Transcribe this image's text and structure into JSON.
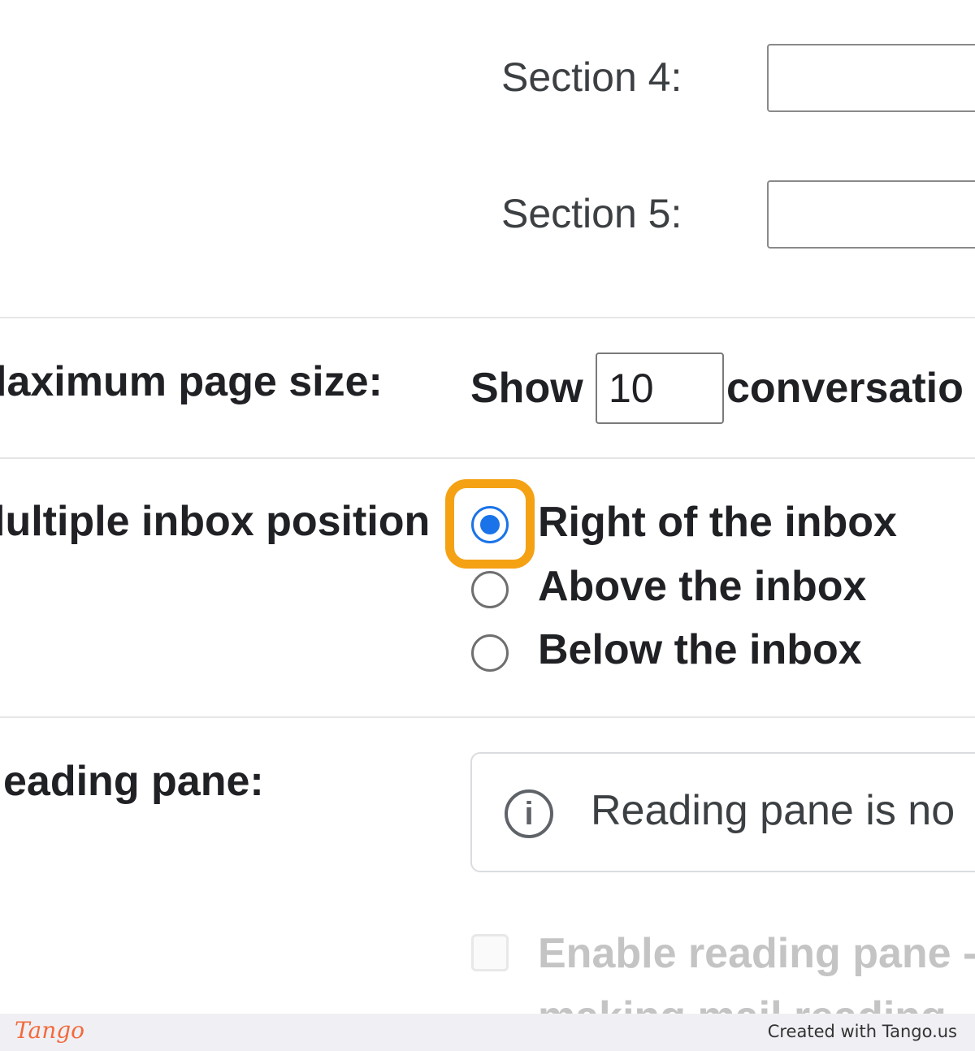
{
  "sections": [
    {
      "label": "Section 4:",
      "value": ""
    },
    {
      "label": "Section 5:",
      "value": ""
    }
  ],
  "page_size": {
    "label": "laximum page size:",
    "show_text": "Show",
    "value": "10",
    "suffix": "conversatio"
  },
  "inbox_position": {
    "label": "lultiple inbox position",
    "options": [
      {
        "label": "Right of the inbox",
        "checked": true
      },
      {
        "label": "Above the inbox",
        "checked": false
      },
      {
        "label": "Below the inbox",
        "checked": false
      }
    ]
  },
  "reading_pane": {
    "label": "eading pane:",
    "info_text": "Reading pane is no",
    "checkbox_label": "Enable reading pane -",
    "checkbox_sub": "making mail reading"
  },
  "footer": {
    "logo": "Tango",
    "credit": "Created with Tango.us"
  },
  "colors": {
    "radio_selected": "#1a73e8",
    "highlight": "#f5a114",
    "tango_brand": "#f26a3d"
  }
}
